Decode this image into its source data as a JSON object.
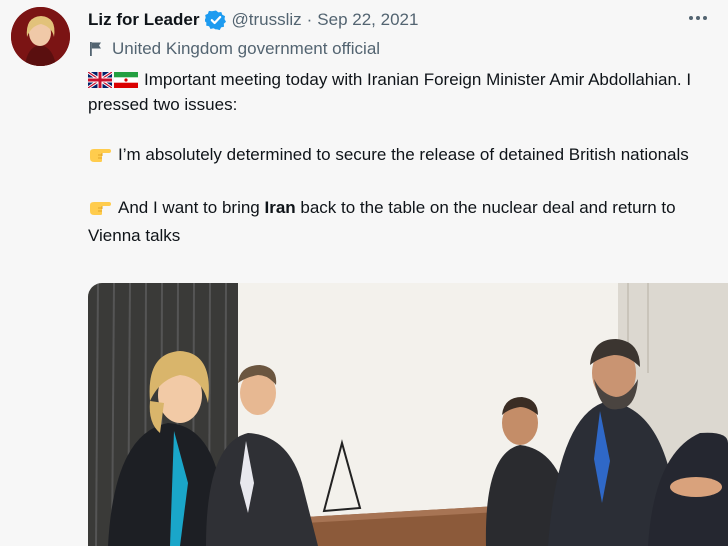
{
  "author": {
    "name": "Liz for Leader",
    "handle": "@trussliz",
    "date": "Sep 22, 2021",
    "affiliation": "United Kingdom government official",
    "verified_color": "#1d9bf0"
  },
  "tweet": {
    "line1": "Important meeting today with Iranian Foreign Minister Amir Abdollahian. I pressed two issues:",
    "point1": "I’m absolutely determined to secure the release of detained British nationals",
    "point2_pre": "And I want to bring ",
    "point2_bold": "Iran",
    "point2_post": " back to the table on the nuclear deal and return to Vienna talks"
  },
  "icons": {
    "more": "more-icon",
    "flag": "flag-icon",
    "uk_flag": "uk-flag-icon",
    "iran_flag": "iran-flag-icon",
    "pointing": "pointing-right-icon",
    "verified": "verified-badge-icon"
  },
  "colors": {
    "muted_text": "#536471",
    "text": "#0f1419",
    "background": "#f7f7f7"
  }
}
